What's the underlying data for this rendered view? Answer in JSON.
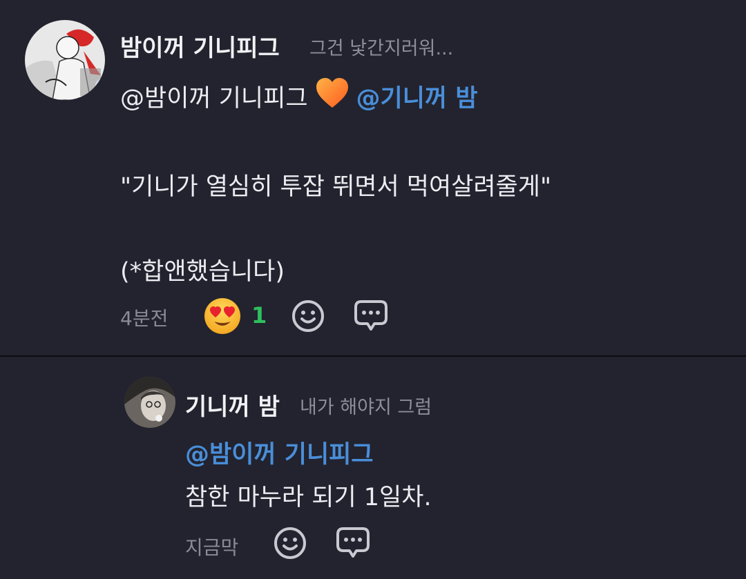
{
  "comment1": {
    "username": "밤이꺼 기니피그",
    "status": "그건 낯간지러워...",
    "line1_text": "@밤이꺼 기니피그",
    "line1_mention": "@기니꺼 밤",
    "line1_emoji": "orange-heart",
    "quote": "\"기니가 열심히 투잡 뛰면서 먹여살려줄게\"",
    "note": "(*합앤했습니다)",
    "time": "4분전",
    "reaction_count": "1",
    "reaction_emoji": "heart-eyes"
  },
  "comment2": {
    "username": "기니꺼 밤",
    "status": "내가 해야지 그럼",
    "mention": "@밤이꺼 기니피그",
    "body": "참한 마누라 되기 1일차.",
    "time": "지금막"
  },
  "colors": {
    "background": "#22232e",
    "mention": "#4a8ed9",
    "reaction_count": "#2fbf5e",
    "muted": "#8a8b96"
  }
}
